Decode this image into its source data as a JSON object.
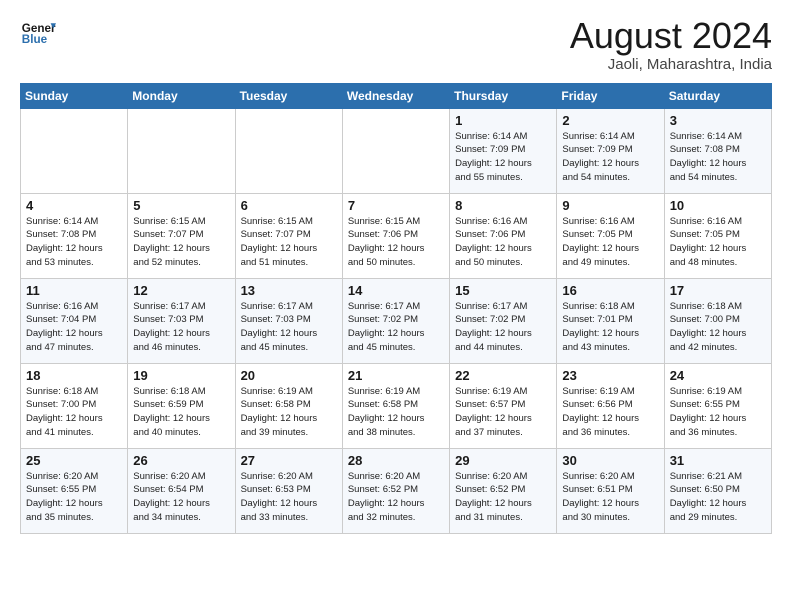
{
  "header": {
    "logo_line1": "General",
    "logo_line2": "Blue",
    "month": "August 2024",
    "location": "Jaoli, Maharashtra, India"
  },
  "days_of_week": [
    "Sunday",
    "Monday",
    "Tuesday",
    "Wednesday",
    "Thursday",
    "Friday",
    "Saturday"
  ],
  "weeks": [
    [
      {
        "day": "",
        "info": ""
      },
      {
        "day": "",
        "info": ""
      },
      {
        "day": "",
        "info": ""
      },
      {
        "day": "",
        "info": ""
      },
      {
        "day": "1",
        "info": "Sunrise: 6:14 AM\nSunset: 7:09 PM\nDaylight: 12 hours\nand 55 minutes."
      },
      {
        "day": "2",
        "info": "Sunrise: 6:14 AM\nSunset: 7:09 PM\nDaylight: 12 hours\nand 54 minutes."
      },
      {
        "day": "3",
        "info": "Sunrise: 6:14 AM\nSunset: 7:08 PM\nDaylight: 12 hours\nand 54 minutes."
      }
    ],
    [
      {
        "day": "4",
        "info": "Sunrise: 6:14 AM\nSunset: 7:08 PM\nDaylight: 12 hours\nand 53 minutes."
      },
      {
        "day": "5",
        "info": "Sunrise: 6:15 AM\nSunset: 7:07 PM\nDaylight: 12 hours\nand 52 minutes."
      },
      {
        "day": "6",
        "info": "Sunrise: 6:15 AM\nSunset: 7:07 PM\nDaylight: 12 hours\nand 51 minutes."
      },
      {
        "day": "7",
        "info": "Sunrise: 6:15 AM\nSunset: 7:06 PM\nDaylight: 12 hours\nand 50 minutes."
      },
      {
        "day": "8",
        "info": "Sunrise: 6:16 AM\nSunset: 7:06 PM\nDaylight: 12 hours\nand 50 minutes."
      },
      {
        "day": "9",
        "info": "Sunrise: 6:16 AM\nSunset: 7:05 PM\nDaylight: 12 hours\nand 49 minutes."
      },
      {
        "day": "10",
        "info": "Sunrise: 6:16 AM\nSunset: 7:05 PM\nDaylight: 12 hours\nand 48 minutes."
      }
    ],
    [
      {
        "day": "11",
        "info": "Sunrise: 6:16 AM\nSunset: 7:04 PM\nDaylight: 12 hours\nand 47 minutes."
      },
      {
        "day": "12",
        "info": "Sunrise: 6:17 AM\nSunset: 7:03 PM\nDaylight: 12 hours\nand 46 minutes."
      },
      {
        "day": "13",
        "info": "Sunrise: 6:17 AM\nSunset: 7:03 PM\nDaylight: 12 hours\nand 45 minutes."
      },
      {
        "day": "14",
        "info": "Sunrise: 6:17 AM\nSunset: 7:02 PM\nDaylight: 12 hours\nand 45 minutes."
      },
      {
        "day": "15",
        "info": "Sunrise: 6:17 AM\nSunset: 7:02 PM\nDaylight: 12 hours\nand 44 minutes."
      },
      {
        "day": "16",
        "info": "Sunrise: 6:18 AM\nSunset: 7:01 PM\nDaylight: 12 hours\nand 43 minutes."
      },
      {
        "day": "17",
        "info": "Sunrise: 6:18 AM\nSunset: 7:00 PM\nDaylight: 12 hours\nand 42 minutes."
      }
    ],
    [
      {
        "day": "18",
        "info": "Sunrise: 6:18 AM\nSunset: 7:00 PM\nDaylight: 12 hours\nand 41 minutes."
      },
      {
        "day": "19",
        "info": "Sunrise: 6:18 AM\nSunset: 6:59 PM\nDaylight: 12 hours\nand 40 minutes."
      },
      {
        "day": "20",
        "info": "Sunrise: 6:19 AM\nSunset: 6:58 PM\nDaylight: 12 hours\nand 39 minutes."
      },
      {
        "day": "21",
        "info": "Sunrise: 6:19 AM\nSunset: 6:58 PM\nDaylight: 12 hours\nand 38 minutes."
      },
      {
        "day": "22",
        "info": "Sunrise: 6:19 AM\nSunset: 6:57 PM\nDaylight: 12 hours\nand 37 minutes."
      },
      {
        "day": "23",
        "info": "Sunrise: 6:19 AM\nSunset: 6:56 PM\nDaylight: 12 hours\nand 36 minutes."
      },
      {
        "day": "24",
        "info": "Sunrise: 6:19 AM\nSunset: 6:55 PM\nDaylight: 12 hours\nand 36 minutes."
      }
    ],
    [
      {
        "day": "25",
        "info": "Sunrise: 6:20 AM\nSunset: 6:55 PM\nDaylight: 12 hours\nand 35 minutes."
      },
      {
        "day": "26",
        "info": "Sunrise: 6:20 AM\nSunset: 6:54 PM\nDaylight: 12 hours\nand 34 minutes."
      },
      {
        "day": "27",
        "info": "Sunrise: 6:20 AM\nSunset: 6:53 PM\nDaylight: 12 hours\nand 33 minutes."
      },
      {
        "day": "28",
        "info": "Sunrise: 6:20 AM\nSunset: 6:52 PM\nDaylight: 12 hours\nand 32 minutes."
      },
      {
        "day": "29",
        "info": "Sunrise: 6:20 AM\nSunset: 6:52 PM\nDaylight: 12 hours\nand 31 minutes."
      },
      {
        "day": "30",
        "info": "Sunrise: 6:20 AM\nSunset: 6:51 PM\nDaylight: 12 hours\nand 30 minutes."
      },
      {
        "day": "31",
        "info": "Sunrise: 6:21 AM\nSunset: 6:50 PM\nDaylight: 12 hours\nand 29 minutes."
      }
    ]
  ]
}
